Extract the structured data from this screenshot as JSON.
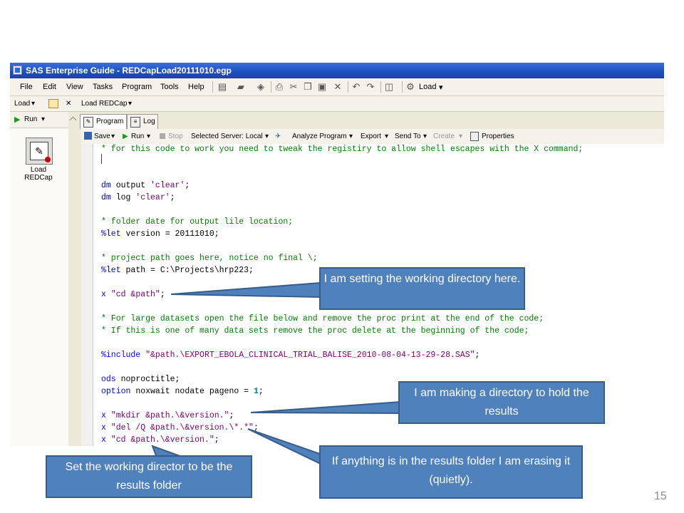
{
  "window": {
    "title": "SAS Enterprise Guide - REDCapLoad20111010.egp"
  },
  "menu": [
    "File",
    "Edit",
    "View",
    "Tasks",
    "Program",
    "Tools",
    "Help"
  ],
  "toolbar": {
    "load_label": "Load"
  },
  "load_toolbar": {
    "load": "Load",
    "close": "✕",
    "project": "Load REDCap"
  },
  "left_pane": {
    "run": "Run",
    "node_label": "Load REDCap"
  },
  "tabs": [
    {
      "label": "Program",
      "icon": "program-icon"
    },
    {
      "label": "Log",
      "icon": "log-icon"
    }
  ],
  "program_toolbar": {
    "save": "Save",
    "run": "Run",
    "stop": "Stop",
    "server": "Selected Server: Local",
    "analyze": "Analyze Program",
    "export": "Export",
    "send_to": "Send To",
    "create": "Create",
    "properties": "Properties"
  },
  "code_lines": [
    "* for this code to work you need to tweak the registiry to allow shell escapes with the X command;",
    "",
    "dm output 'clear';",
    "dm log 'clear';",
    "",
    "* folder date for output lile location;",
    "%let version = 20111010;",
    "",
    "* project path goes here, notice no final \\;",
    "%let path = C:\\Projects\\hrp223;",
    "",
    "x \"cd &path\";",
    "",
    "* For large datasets open the file below and remove the proc print at the end of the code;",
    "* If this is one of many data sets remove the proc delete at the beginning of the code;",
    "",
    "%include \"&path.\\EXPORT_EBOLA_CLINICAL_TRIAL_BALISE_2010-08-04-13-29-28.SAS\";",
    "",
    "ods noproctitle;",
    "option noxwait nodate pageno = 1;",
    "",
    "x \"mkdir &path.\\&version.\";",
    "x \"del /Q &path.\\&version.\\*.*\";",
    "x \"cd &path.\\&version.\";"
  ],
  "callouts": {
    "working_dir": "I am setting the working directory here.",
    "mkdir": "I am making a directory to hold the results",
    "erase": "If anything is in the results folder I am erasing it (quietly).",
    "results_dir": "Set the working director to be the results folder"
  },
  "page_number": "15",
  "colors": {
    "callout_fill": "#4f81bd",
    "callout_border": "#385d8a",
    "title_bar": "#1d4fc0"
  }
}
